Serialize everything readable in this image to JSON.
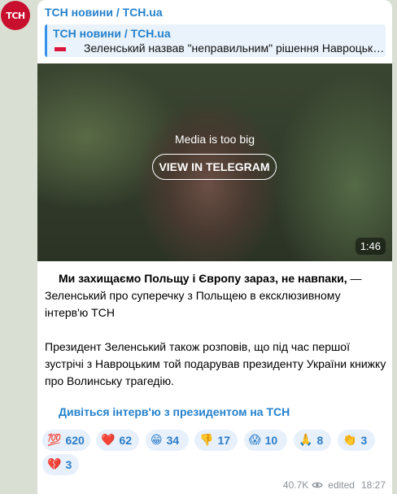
{
  "channel": {
    "avatar_text": "ТСН",
    "name": "ТСН новини / TCH.ua"
  },
  "reply": {
    "title": "ТСН новини / TCH.ua",
    "text": "Зеленський назвав \"неправильним\" рішення Навроцького..."
  },
  "media": {
    "note": "Media is too big",
    "button": "VIEW IN TELEGRAM",
    "duration": "1:46"
  },
  "message": {
    "bold": "Ми захищаємо Польщу і Європу зараз, не навпаки,",
    "rest": " — Зеленський про суперечку з Польщею в ексклюзивному інтерв'ю ТСН",
    "para2": "Президент Зеленський також розповів, що під час першої зустрічі з Навроцьким той подарував президенту України книжку про Волинську трагедію.",
    "link": "Дивіться інтерв'ю з президентом на ТСН"
  },
  "reactions": [
    {
      "emoji": "💯",
      "count": "620"
    },
    {
      "emoji": "❤️",
      "count": "62"
    },
    {
      "emoji": "😁",
      "count": "34"
    },
    {
      "emoji": "👎",
      "count": "17"
    },
    {
      "emoji": "😱",
      "count": "10"
    },
    {
      "emoji": "🙏",
      "count": "8"
    },
    {
      "emoji": "👏",
      "count": "3"
    },
    {
      "emoji": "💔",
      "count": "3"
    }
  ],
  "footer": {
    "views": "40.7K",
    "edited": "edited",
    "time": "18:27"
  }
}
